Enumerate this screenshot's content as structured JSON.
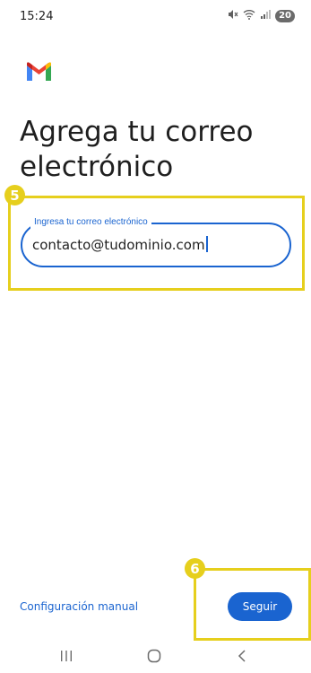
{
  "status": {
    "time": "15:24",
    "battery": "20"
  },
  "icons": {
    "logo": "gmail-logo",
    "mute": "mute-icon",
    "wifi": "wifi-icon",
    "signal": "signal-icon",
    "recents": "recents-icon",
    "home": "home-icon",
    "back": "back-icon"
  },
  "screen": {
    "title": "Agrega tu correo electrónico",
    "email_field": {
      "label": "Ingresa tu correo electrónico",
      "value": "contacto@tudominio.com"
    },
    "manual_link": "Configuración manual",
    "next_button": "Seguir"
  },
  "annotations": {
    "step_a": "5",
    "step_b": "6"
  },
  "colors": {
    "accent": "#1a64d0",
    "highlight": "#e6cf1d"
  }
}
